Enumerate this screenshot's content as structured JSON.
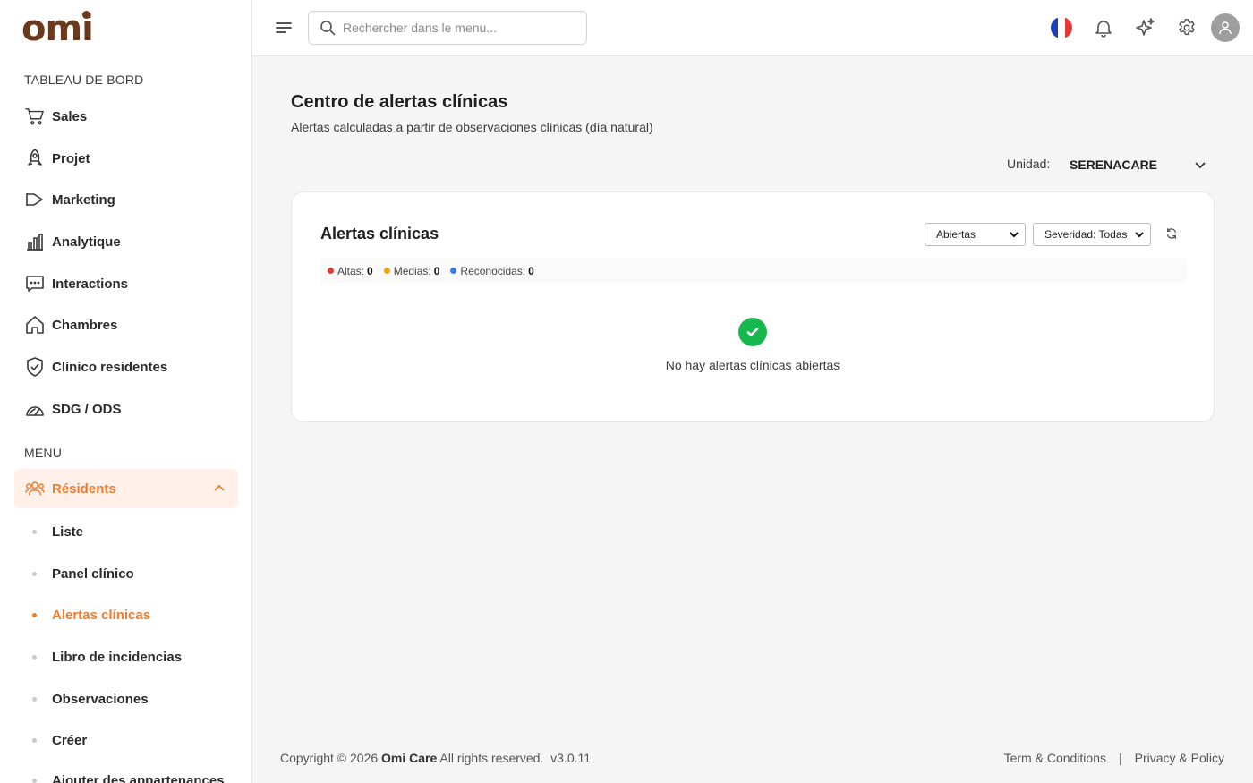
{
  "brand": {
    "logo": "omi"
  },
  "sidebar": {
    "dashboard_title": "TABLEAU DE BORD",
    "dashboard_items": [
      {
        "label": "Sales",
        "icon": "cart-icon"
      },
      {
        "label": "Projet",
        "icon": "rocket-icon"
      },
      {
        "label": "Marketing",
        "icon": "megaphone-icon"
      },
      {
        "label": "Analytique",
        "icon": "bar-chart-icon"
      },
      {
        "label": "Interactions",
        "icon": "chat-icon"
      },
      {
        "label": "Chambres",
        "icon": "home-icon"
      },
      {
        "label": "Clínico residentes",
        "icon": "shield-check-icon"
      },
      {
        "label": "SDG / ODS",
        "icon": "gauge-icon"
      }
    ],
    "menu_title": "MENU",
    "residents": {
      "label": "Résidents",
      "icon": "users-icon",
      "expanded": true
    },
    "sub_items": [
      {
        "label": "Liste",
        "active": false
      },
      {
        "label": "Panel clínico",
        "active": false
      },
      {
        "label": "Alertas clínicas",
        "active": true
      },
      {
        "label": "Libro de incidencias",
        "active": false
      },
      {
        "label": "Observaciones",
        "active": false
      },
      {
        "label": "Créer",
        "active": false
      },
      {
        "label": "Ajouter des appartenances",
        "active": false
      }
    ],
    "accent_color": "#f07b2c"
  },
  "topbar": {
    "search_placeholder": "Rechercher dans le menu...",
    "language": "fr",
    "icons": [
      "menu-icon",
      "search-icon",
      "france-flag-icon",
      "bell-icon",
      "sparkles-icon",
      "gear-icon",
      "user-avatar-icon"
    ]
  },
  "main": {
    "title": "Centro de alertas clínicas",
    "subtitle": "Alertas calculadas a partir de observaciones clínicas (día natural)",
    "unit_label": "Unidad:",
    "unit_value": "SERENACARE",
    "card": {
      "title": "Alertas clínicas",
      "status_filter": "Abiertas",
      "severity_filter": "Severidad: Todas",
      "summary": [
        {
          "label": "Altas:",
          "value": "0",
          "color": "#e53935"
        },
        {
          "label": "Medias:",
          "value": "0",
          "color": "#f0a500"
        },
        {
          "label": "Reconocidas:",
          "value": "0",
          "color": "#3b7de8"
        }
      ],
      "empty_text": "No hay alertas clínicas abiertas",
      "empty_icon_color": "#16b84e"
    }
  },
  "footer": {
    "copyright_prefix": "Copyright © 2026",
    "company": "Omi Care",
    "rights": "All rights reserved.",
    "version": "v3.0.11",
    "terms": "Term & Conditions",
    "separator": "|",
    "privacy": "Privacy & Policy"
  }
}
